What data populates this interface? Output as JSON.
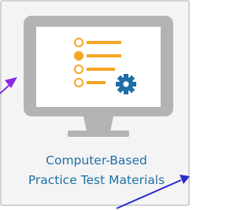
{
  "tile": {
    "label_line1": "Computer-Based",
    "label_line2": "Practice Test Materials",
    "icon": "monitor-checklist-gear-icon"
  },
  "colors": {
    "tile_background": "#f4f4f4",
    "tile_border": "#d2d2d2",
    "monitor_gray": "#b3b3b3",
    "screen_white": "#ffffff",
    "list_orange": "#f5a623",
    "gear_blue": "#1f6fa5",
    "label_blue": "#1f6fa5",
    "annotation_arrow_purple": "#8a2be2",
    "annotation_arrow_blue": "#2a2ad0"
  },
  "annotations": {
    "arrow_left": "annotation-arrow-purple",
    "arrow_bottom": "annotation-arrow-blue"
  }
}
